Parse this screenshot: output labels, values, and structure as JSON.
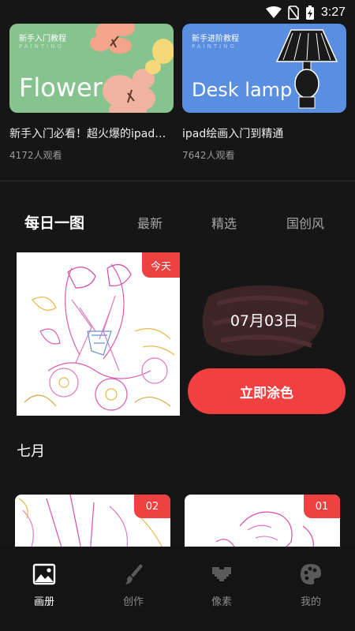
{
  "status": {
    "time": "3:27"
  },
  "courses": [
    {
      "thumb_kicker": "新手入门教程",
      "thumb_sub": "PAINTING",
      "thumb_word": "Flower",
      "title": "新手入门必看！超火爆的ipad…",
      "viewers": "4172人观看"
    },
    {
      "thumb_kicker": "新手进阶教程",
      "thumb_sub": "PAINTING",
      "thumb_word": "Desk lamp",
      "title": "ipad绘画入门到精通",
      "viewers": "7642人观看"
    }
  ],
  "tabs": [
    "每日一图",
    "最新",
    "精选",
    "国创风"
  ],
  "daily": {
    "badge": "今天",
    "date": "07月03日",
    "button": "立即涂色"
  },
  "month": "七月",
  "gallery": [
    {
      "badge": "02"
    },
    {
      "badge": "01"
    }
  ],
  "nav": [
    {
      "label": "画册",
      "icon": "album-icon"
    },
    {
      "label": "创作",
      "icon": "brush-icon"
    },
    {
      "label": "像素",
      "icon": "pixel-heart-icon"
    },
    {
      "label": "我的",
      "icon": "palette-icon"
    }
  ],
  "colors": {
    "accent": "#f23f3f",
    "badge": "#ee4242",
    "background": "#161616",
    "flower_card": "#86c38e",
    "lamp_card": "#5a8ee0"
  }
}
